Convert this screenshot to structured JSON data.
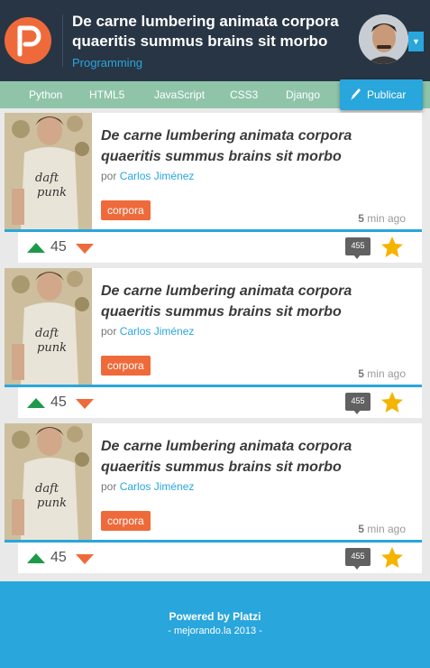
{
  "header": {
    "title": "De carne lumbering animata corpora quaeritis summus brains sit morbo",
    "category": "Programming"
  },
  "nav": {
    "items": [
      {
        "label": "Python"
      },
      {
        "label": "HTML5"
      },
      {
        "label": "JavaScript"
      },
      {
        "label": "CSS3"
      },
      {
        "label": "Django"
      }
    ],
    "publish_label": "Publicar"
  },
  "cards": [
    {
      "title": "De carne lumbering animata corpora quaeritis summus brains sit morbo",
      "author_prefix": "por",
      "author": "Carlos Jiménez",
      "tag": "corpora",
      "time_num": "5",
      "time_unit": "min ago",
      "votes": "45",
      "comments": "455"
    },
    {
      "title": "De carne lumbering animata corpora quaeritis summus brains sit morbo",
      "author_prefix": "por",
      "author": "Carlos Jiménez",
      "tag": "corpora",
      "time_num": "5",
      "time_unit": "min ago",
      "votes": "45",
      "comments": "455"
    },
    {
      "title": "De carne lumbering animata corpora quaeritis summus brains sit morbo",
      "author_prefix": "por",
      "author": "Carlos Jiménez",
      "tag": "corpora",
      "time_num": "5",
      "time_unit": "min ago",
      "votes": "45",
      "comments": "455"
    }
  ],
  "footer": {
    "powered": "Powered by Platzi",
    "copyright": "- mejorando.la 2013 -"
  },
  "colors": {
    "header_bg": "#283544",
    "accent_blue": "#29a6dc",
    "accent_orange": "#ef6a3a",
    "nav_bg": "#8fc4a9",
    "upvote_green": "#1c9a4a",
    "star_yellow": "#f5b400"
  },
  "icons": {
    "logo": "platzi-logo",
    "publish": "pen-icon",
    "upvote": "arrow-up-icon",
    "downvote": "arrow-down-icon",
    "comments": "comment-bubble-icon",
    "favorite": "star-icon",
    "avatar_dropdown": "caret-down-icon"
  }
}
